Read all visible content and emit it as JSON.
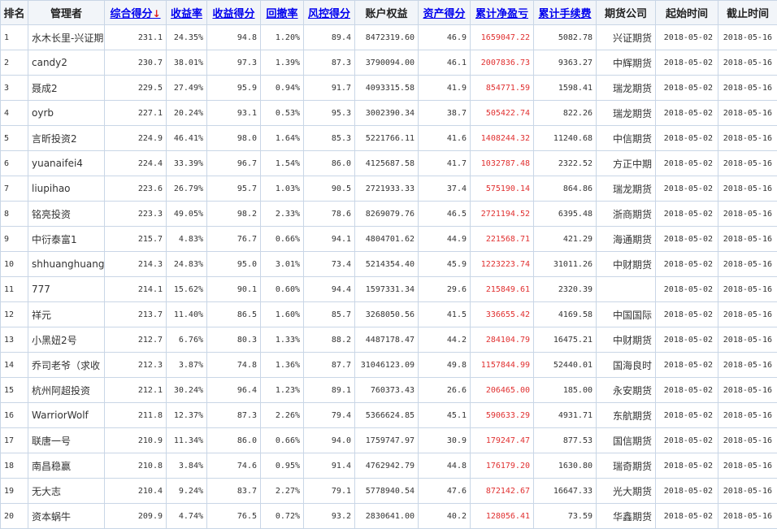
{
  "headers": {
    "rank": "排名",
    "manager": "管理者",
    "composite_score": "综合得分",
    "sort_arrow": "↓",
    "return_rate": "收益率",
    "return_score": "收益得分",
    "drawdown": "回撤率",
    "risk_score": "风控得分",
    "equity": "账户权益",
    "asset_score": "资产得分",
    "net_pnl": "累计净盈亏",
    "fees": "累计手续费",
    "broker": "期货公司",
    "start_date": "起始时间",
    "end_date": "截止时间"
  },
  "rows": [
    {
      "rank": "1",
      "manager": "水木长里-兴证期",
      "composite": "231.1",
      "return_rate": "24.35%",
      "return_score": "94.8",
      "drawdown": "1.20%",
      "risk_score": "89.4",
      "equity": "8472319.60",
      "asset_score": "46.9",
      "net_pnl": "1659047.22",
      "fees": "5082.78",
      "broker": "兴证期货",
      "start": "2018-05-02",
      "end": "2018-05-16"
    },
    {
      "rank": "2",
      "manager": "candy2",
      "composite": "230.7",
      "return_rate": "38.01%",
      "return_score": "97.3",
      "drawdown": "1.39%",
      "risk_score": "87.3",
      "equity": "3790094.00",
      "asset_score": "46.1",
      "net_pnl": "2007836.73",
      "fees": "9363.27",
      "broker": "中辉期货",
      "start": "2018-05-02",
      "end": "2018-05-16"
    },
    {
      "rank": "3",
      "manager": "聂成2",
      "composite": "229.5",
      "return_rate": "27.49%",
      "return_score": "95.9",
      "drawdown": "0.94%",
      "risk_score": "91.7",
      "equity": "4093315.58",
      "asset_score": "41.9",
      "net_pnl": "854771.59",
      "fees": "1598.41",
      "broker": "瑞龙期货",
      "start": "2018-05-02",
      "end": "2018-05-16"
    },
    {
      "rank": "4",
      "manager": "oyrb",
      "composite": "227.1",
      "return_rate": "20.24%",
      "return_score": "93.1",
      "drawdown": "0.53%",
      "risk_score": "95.3",
      "equity": "3002390.34",
      "asset_score": "38.7",
      "net_pnl": "505422.74",
      "fees": "822.26",
      "broker": "瑞龙期货",
      "start": "2018-05-02",
      "end": "2018-05-16"
    },
    {
      "rank": "5",
      "manager": "言昕投资2",
      "composite": "224.9",
      "return_rate": "46.41%",
      "return_score": "98.0",
      "drawdown": "1.64%",
      "risk_score": "85.3",
      "equity": "5221766.11",
      "asset_score": "41.6",
      "net_pnl": "1408244.32",
      "fees": "11240.68",
      "broker": "中信期货",
      "start": "2018-05-02",
      "end": "2018-05-16"
    },
    {
      "rank": "6",
      "manager": "yuanaifei4",
      "composite": "224.4",
      "return_rate": "33.39%",
      "return_score": "96.7",
      "drawdown": "1.54%",
      "risk_score": "86.0",
      "equity": "4125687.58",
      "asset_score": "41.7",
      "net_pnl": "1032787.48",
      "fees": "2322.52",
      "broker": "方正中期",
      "start": "2018-05-02",
      "end": "2018-05-16"
    },
    {
      "rank": "7",
      "manager": "liupihao",
      "composite": "223.6",
      "return_rate": "26.79%",
      "return_score": "95.7",
      "drawdown": "1.03%",
      "risk_score": "90.5",
      "equity": "2721933.33",
      "asset_score": "37.4",
      "net_pnl": "575190.14",
      "fees": "864.86",
      "broker": "瑞龙期货",
      "start": "2018-05-02",
      "end": "2018-05-16"
    },
    {
      "rank": "8",
      "manager": "铭亮投资",
      "composite": "223.3",
      "return_rate": "49.05%",
      "return_score": "98.2",
      "drawdown": "2.33%",
      "risk_score": "78.6",
      "equity": "8269079.76",
      "asset_score": "46.5",
      "net_pnl": "2721194.52",
      "fees": "6395.48",
      "broker": "浙商期货",
      "start": "2018-05-02",
      "end": "2018-05-16"
    },
    {
      "rank": "9",
      "manager": "中衍泰富1",
      "composite": "215.7",
      "return_rate": "4.83%",
      "return_score": "76.7",
      "drawdown": "0.66%",
      "risk_score": "94.1",
      "equity": "4804701.62",
      "asset_score": "44.9",
      "net_pnl": "221568.71",
      "fees": "421.29",
      "broker": "海通期货",
      "start": "2018-05-02",
      "end": "2018-05-16"
    },
    {
      "rank": "10",
      "manager": "shhuanghuang",
      "composite": "214.3",
      "return_rate": "24.83%",
      "return_score": "95.0",
      "drawdown": "3.01%",
      "risk_score": "73.4",
      "equity": "5214354.40",
      "asset_score": "45.9",
      "net_pnl": "1223223.74",
      "fees": "31011.26",
      "broker": "中财期货",
      "start": "2018-05-02",
      "end": "2018-05-16"
    },
    {
      "rank": "11",
      "manager": "777",
      "composite": "214.1",
      "return_rate": "15.62%",
      "return_score": "90.1",
      "drawdown": "0.60%",
      "risk_score": "94.4",
      "equity": "1597331.34",
      "asset_score": "29.6",
      "net_pnl": "215849.61",
      "fees": "2320.39",
      "broker": "",
      "start": "2018-05-02",
      "end": "2018-05-16"
    },
    {
      "rank": "12",
      "manager": "祥元",
      "composite": "213.7",
      "return_rate": "11.40%",
      "return_score": "86.5",
      "drawdown": "1.60%",
      "risk_score": "85.7",
      "equity": "3268050.56",
      "asset_score": "41.5",
      "net_pnl": "336655.42",
      "fees": "4169.58",
      "broker": "中国国际",
      "start": "2018-05-02",
      "end": "2018-05-16"
    },
    {
      "rank": "13",
      "manager": "小黑妞2号",
      "composite": "212.7",
      "return_rate": "6.76%",
      "return_score": "80.3",
      "drawdown": "1.33%",
      "risk_score": "88.2",
      "equity": "4487178.47",
      "asset_score": "44.2",
      "net_pnl": "284104.79",
      "fees": "16475.21",
      "broker": "中财期货",
      "start": "2018-05-02",
      "end": "2018-05-16"
    },
    {
      "rank": "14",
      "manager": "乔司老爷（求收",
      "composite": "212.3",
      "return_rate": "3.87%",
      "return_score": "74.8",
      "drawdown": "1.36%",
      "risk_score": "87.7",
      "equity": "31046123.09",
      "asset_score": "49.8",
      "net_pnl": "1157844.99",
      "fees": "52440.01",
      "broker": "国海良时",
      "start": "2018-05-02",
      "end": "2018-05-16"
    },
    {
      "rank": "15",
      "manager": "杭州阿超投资",
      "composite": "212.1",
      "return_rate": "30.24%",
      "return_score": "96.4",
      "drawdown": "1.23%",
      "risk_score": "89.1",
      "equity": "760373.43",
      "asset_score": "26.6",
      "net_pnl": "206465.00",
      "fees": "185.00",
      "broker": "永安期货",
      "start": "2018-05-02",
      "end": "2018-05-16"
    },
    {
      "rank": "16",
      "manager": "WarriorWolf",
      "composite": "211.8",
      "return_rate": "12.37%",
      "return_score": "87.3",
      "drawdown": "2.26%",
      "risk_score": "79.4",
      "equity": "5366624.85",
      "asset_score": "45.1",
      "net_pnl": "590633.29",
      "fees": "4931.71",
      "broker": "东航期货",
      "start": "2018-05-02",
      "end": "2018-05-16"
    },
    {
      "rank": "17",
      "manager": "联唐一号",
      "composite": "210.9",
      "return_rate": "11.34%",
      "return_score": "86.0",
      "drawdown": "0.66%",
      "risk_score": "94.0",
      "equity": "1759747.97",
      "asset_score": "30.9",
      "net_pnl": "179247.47",
      "fees": "877.53",
      "broker": "国信期货",
      "start": "2018-05-02",
      "end": "2018-05-16"
    },
    {
      "rank": "18",
      "manager": "南昌稳赢",
      "composite": "210.8",
      "return_rate": "3.84%",
      "return_score": "74.6",
      "drawdown": "0.95%",
      "risk_score": "91.4",
      "equity": "4762942.79",
      "asset_score": "44.8",
      "net_pnl": "176179.20",
      "fees": "1630.80",
      "broker": "瑞奇期货",
      "start": "2018-05-02",
      "end": "2018-05-16"
    },
    {
      "rank": "19",
      "manager": "无大志",
      "composite": "210.4",
      "return_rate": "9.24%",
      "return_score": "83.7",
      "drawdown": "2.27%",
      "risk_score": "79.1",
      "equity": "5778940.54",
      "asset_score": "47.6",
      "net_pnl": "872142.67",
      "fees": "16647.33",
      "broker": "光大期货",
      "start": "2018-05-02",
      "end": "2018-05-16"
    },
    {
      "rank": "20",
      "manager": "资本蜗牛",
      "composite": "209.9",
      "return_rate": "4.74%",
      "return_score": "76.5",
      "drawdown": "0.72%",
      "risk_score": "93.2",
      "equity": "2830641.00",
      "asset_score": "40.2",
      "net_pnl": "128056.41",
      "fees": "73.59",
      "broker": "华鑫期货",
      "start": "2018-05-02",
      "end": "2018-05-16"
    }
  ],
  "colors": {
    "border": "#c9d6e6",
    "header_bg": "#f2f5f9",
    "link": "#0000ee",
    "pnl": "#e03030"
  }
}
